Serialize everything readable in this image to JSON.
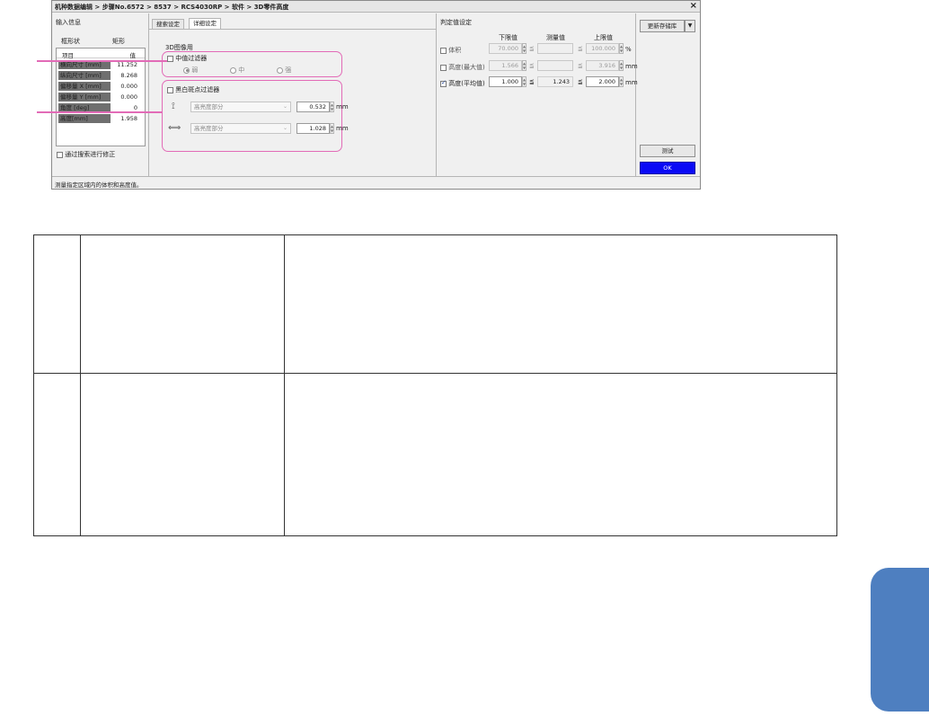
{
  "dialog": {
    "title": "机种数据编辑 > 步骤No.6572 > 8537 > RCS4030RP > 软件 > 3D零件高度",
    "close_glyph": "×"
  },
  "input_info": {
    "section_title": "输入信息",
    "shape_label": "框形状",
    "shape_value": "矩形",
    "table": {
      "col_item": "项目",
      "col_value": "值",
      "rows": [
        {
          "key": "横向尺寸 [mm]",
          "value": "11.252"
        },
        {
          "key": "纵向尺寸 [mm]",
          "value": "8.268"
        },
        {
          "key": "偏移量 X [mm]",
          "value": "0.000"
        },
        {
          "key": "偏移量 Y [mm]",
          "value": "0.000"
        },
        {
          "key": "角度 [deg]",
          "value": "0"
        },
        {
          "key": "高度[mm]",
          "value": "1.958"
        }
      ]
    },
    "correction_checkbox": "通过搜索进行修正"
  },
  "tabs": [
    {
      "label": "搜索设定",
      "active": false
    },
    {
      "label": "详细设定",
      "active": true
    }
  ],
  "detail": {
    "group_title": "3D图像用",
    "median_filter": {
      "label": "中值过滤器",
      "checked": false,
      "options": [
        "弱",
        "中",
        "强"
      ],
      "selected": 0
    },
    "bw_filter": {
      "label": "黑白斑点过滤器",
      "checked": false,
      "rows": [
        {
          "icon": "vertical-size-icon",
          "select": "高亮度部分",
          "value": "0.532",
          "unit": "mm"
        },
        {
          "icon": "horizontal-size-icon",
          "select": "高亮度部分",
          "value": "1.028",
          "unit": "mm"
        }
      ]
    }
  },
  "judge": {
    "section_title": "判定值设定",
    "col_lower": "下限值",
    "col_measured": "测量值",
    "col_upper": "上限值",
    "rows": [
      {
        "label": "体积",
        "checked": false,
        "lower": "70.000",
        "measured": "",
        "upper": "100.000",
        "unit": "%",
        "enabled": false
      },
      {
        "label": "高度(最大值)",
        "checked": false,
        "lower": "1.566",
        "measured": "",
        "upper": "3.916",
        "unit": "mm",
        "enabled": false
      },
      {
        "label": "高度(平均值)",
        "checked": true,
        "lower": "1.000",
        "measured": "1.243",
        "upper": "2.000",
        "unit": "mm",
        "enabled": true
      }
    ],
    "le_symbol": "≦"
  },
  "buttons": {
    "update_library": "更新存储库",
    "update_dropdown": "▼",
    "test": "测试",
    "ok": "OK"
  },
  "status_text": "测量指定区域内的体积和高度值。",
  "colors": {
    "highlight": "#e26bb7",
    "ok_button": "#0a0af5",
    "side_tab": "#4e7fc0"
  }
}
